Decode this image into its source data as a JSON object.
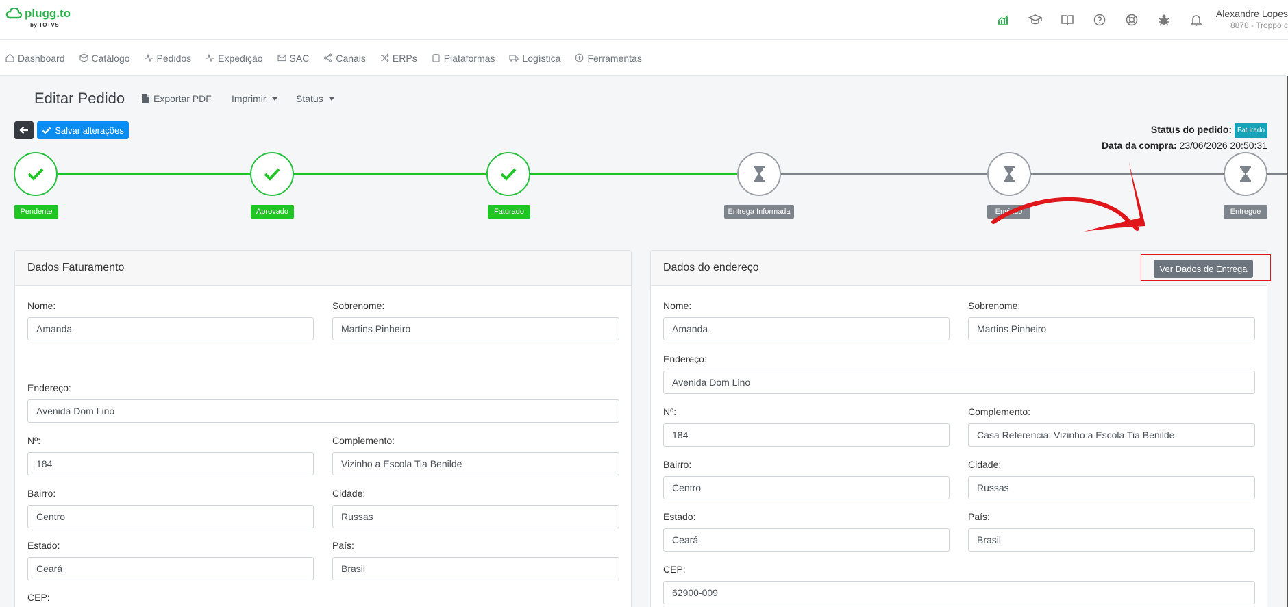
{
  "brand": {
    "name": "plugg.to",
    "sub": "by TOTVS"
  },
  "user": {
    "name": "Alexandre Lopes",
    "org": "8878 - Troppo c"
  },
  "top_icons": [
    "chart-icon",
    "graduation-cap-icon",
    "book-icon",
    "help-icon",
    "support-icon",
    "bug-icon",
    "bell-icon"
  ],
  "nav": [
    {
      "label": "Dashboard",
      "icon": "home-icon"
    },
    {
      "label": "Catálogo",
      "icon": "box-icon"
    },
    {
      "label": "Pedidos",
      "icon": "activity-icon"
    },
    {
      "label": "Expedição",
      "icon": "activity-icon"
    },
    {
      "label": "SAC",
      "icon": "mail-icon"
    },
    {
      "label": "Canais",
      "icon": "share-icon"
    },
    {
      "label": "ERPs",
      "icon": "shuffle-icon"
    },
    {
      "label": "Plataformas",
      "icon": "clipboard-icon"
    },
    {
      "label": "Logística",
      "icon": "truck-icon"
    },
    {
      "label": "Ferramentas",
      "icon": "plus-circle-icon"
    }
  ],
  "page": {
    "title": "Editar Pedido",
    "export_pdf": "Exportar PDF",
    "print": "Imprimir",
    "status": "Status",
    "save": "Salvar alterações"
  },
  "order": {
    "status_label": "Status do pedido:",
    "status_value": "Faturado",
    "date_label": "Data da compra:",
    "date_value": "23/06/2026 20:50:31"
  },
  "steps": [
    {
      "label": "Pendente",
      "state": "done"
    },
    {
      "label": "Aprovado",
      "state": "done"
    },
    {
      "label": "Faturado",
      "state": "done"
    },
    {
      "label": "Entrega Informada",
      "state": "pending"
    },
    {
      "label": "Enviado",
      "state": "pending"
    },
    {
      "label": "Entregue",
      "state": "pending"
    }
  ],
  "billing": {
    "title": "Dados Faturamento",
    "nome_label": "Nome:",
    "nome": "Amanda",
    "sobrenome_label": "Sobrenome:",
    "sobrenome": "Martins Pinheiro",
    "endereco_label": "Endereço:",
    "endereco": "Avenida Dom Lino",
    "numero_label": "Nº:",
    "numero": "184",
    "complemento_label": "Complemento:",
    "complemento": "Vizinho a Escola Tia Benilde",
    "bairro_label": "Bairro:",
    "bairro": "Centro",
    "cidade_label": "Cidade:",
    "cidade": "Russas",
    "estado_label": "Estado:",
    "estado": "Ceará",
    "pais_label": "País:",
    "pais": "Brasil",
    "cep_label": "CEP:"
  },
  "address": {
    "title": "Dados do endereço",
    "button": "Ver Dados de Entrega",
    "nome_label": "Nome:",
    "nome": "Amanda",
    "sobrenome_label": "Sobrenome:",
    "sobrenome": "Martins Pinheiro",
    "endereco_label": "Endereço:",
    "endereco": "Avenida Dom Lino",
    "numero_label": "Nº:",
    "numero": "184",
    "complemento_label": "Complemento:",
    "complemento": "Casa Referencia: Vizinho a Escola Tia Benilde",
    "bairro_label": "Bairro:",
    "bairro": "Centro",
    "cidade_label": "Cidade:",
    "cidade": "Russas",
    "estado_label": "Estado:",
    "estado": "Ceará",
    "pais_label": "País:",
    "pais": "Brasil",
    "cep_label": "CEP:",
    "cep": "62900-009"
  },
  "colors": {
    "brand": "#2bb24c",
    "primary": "#0d8cf0",
    "success": "#1ec524",
    "pending": "#7d848b",
    "annotation": "#e0161b"
  }
}
